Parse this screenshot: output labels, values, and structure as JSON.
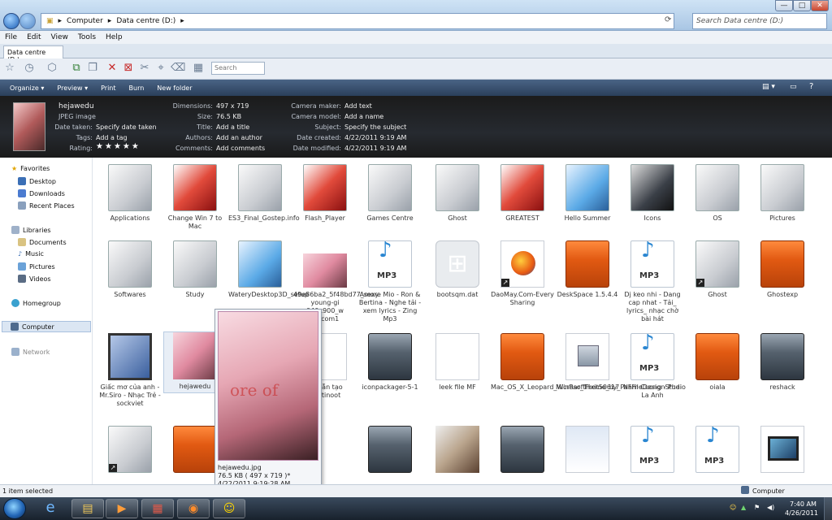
{
  "window": {
    "breadcrumb": [
      "Computer",
      "Data centre (D:)"
    ],
    "search_placeholder": "Search Data centre (D:)",
    "controls": {
      "minimize": "—",
      "maximize": "□",
      "close": "✕"
    }
  },
  "menu": [
    "File",
    "Edit",
    "View",
    "Tools",
    "Help"
  ],
  "tab": {
    "label": "Data centre (D:)"
  },
  "toolbar_search": "Search",
  "commands": [
    "Organize ▾",
    "Preview ▾",
    "Print",
    "Burn",
    "New folder"
  ],
  "details": {
    "file_name": "hejawedu",
    "file_type": "JPEG image",
    "col1": [
      {
        "label": "Date taken:",
        "value": "Specify date taken"
      },
      {
        "label": "Tags:",
        "value": "Add a tag"
      },
      {
        "label": "Rating:",
        "value": ""
      }
    ],
    "rating": 5,
    "col2": [
      {
        "label": "Dimensions:",
        "value": "497 x 719"
      },
      {
        "label": "Size:",
        "value": "76.5 KB"
      },
      {
        "label": "Title:",
        "value": "Add a title"
      },
      {
        "label": "Authors:",
        "value": "Add an author"
      },
      {
        "label": "Comments:",
        "value": "Add comments"
      }
    ],
    "col3": [
      {
        "label": "Camera maker:",
        "value": "Add text"
      },
      {
        "label": "Camera model:",
        "value": "Add a name"
      },
      {
        "label": "Subject:",
        "value": "Specify the subject"
      },
      {
        "label": "Date created:",
        "value": "4/22/2011 9:19 AM"
      },
      {
        "label": "Date modified:",
        "value": "4/22/2011 9:19 AM"
      }
    ]
  },
  "nav": {
    "favorites": "Favorites",
    "favorites_items": [
      "Desktop",
      "Downloads",
      "Recent Places"
    ],
    "libraries": "Libraries",
    "libraries_items": [
      "Documents",
      "Music",
      "Pictures",
      "Videos"
    ],
    "homegroup": "Homegroup",
    "computer": "Computer",
    "network": "Network"
  },
  "files": {
    "row1": [
      "Applications",
      "Change Win 7 to Mac",
      "ES3_Final_Gostep.info",
      "Flash_Player",
      "Games Centre",
      "Ghost",
      "GREATEST",
      "Hello Summer",
      "Icons",
      "OS",
      "Pictures"
    ],
    "row2": [
      "Softwares",
      "Study",
      "WateryDesktop3D_setup",
      "49e86ba2_5f48bd77_sexy-young-gi 940x900_w po.com1",
      "Amore Mio - Ron & Bertina - Nghe tải - xem lyrics - Zing Mp3",
      "bootsqm.dat",
      "DaoMay.Com-Every Sharing",
      "DeskSpace 1.5.4.4",
      "Dj keo nhi - Dang cap nhat - Tải_ lyrics_ nhạc chờ bài hát",
      "Ghost",
      "Ghostexp"
    ],
    "row3": [
      "Giấc mơ của anh - Mr.Siro - Nhạc Trẻ - sockviet",
      "hejawedu",
      "",
      "ng dẫn tạo multinoot",
      "iconpackager-5-1",
      "leek file MF",
      "Mac_OS_X_Leopard_WinRar_Theme_by_PaFFileDesignStudio",
      "MicrosoftFixit50617",
      "Nam Cuong - Phai La Anh",
      "oiala",
      "reshack"
    ],
    "mp3_label": "MP3"
  },
  "tooltip": {
    "name": "hejawedu.jpg",
    "size": "76.5 KB   ( 497 x 719 )*",
    "date": "4/22/2011 9:19:28 AM",
    "watermark": "ore of"
  },
  "status": {
    "selected": "1 item selected",
    "location": "Computer"
  },
  "tray": {
    "time": "7:40 AM",
    "date": "4/26/2011"
  }
}
